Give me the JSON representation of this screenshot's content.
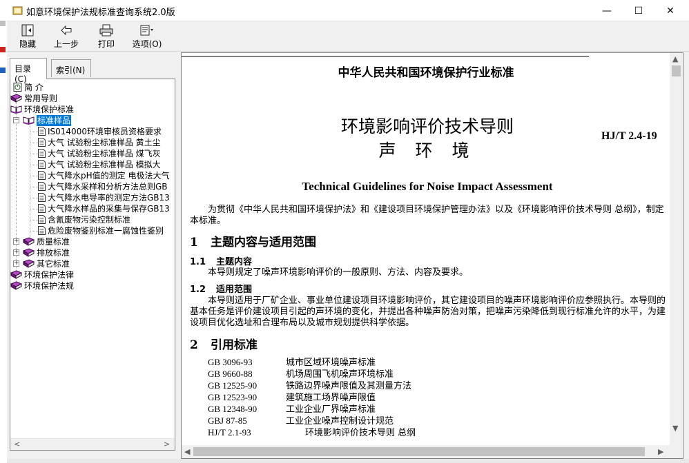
{
  "window": {
    "title": "如意环境保护法规标准查询系统2.0版",
    "minimize": "—",
    "maximize": "☐",
    "close": "✕"
  },
  "toolbar": {
    "hide": "隐藏",
    "back": "上一步",
    "print": "打印",
    "options": "选项(O)"
  },
  "tabs": {
    "contents": "目录(C)",
    "index": "索引(N)"
  },
  "tree": {
    "items": [
      {
        "label": "简  介",
        "icon": "help-page-icon"
      },
      {
        "label": "常用导则",
        "icon": "book-icon"
      },
      {
        "label": "环境保护标准",
        "icon": "book-open-icon"
      },
      {
        "label": "标准样品",
        "icon": "book-open-icon"
      },
      {
        "label": "IS014000环境审核员资格要求",
        "icon": "page-icon"
      },
      {
        "label": "大气 试验粉尘标准样品 黄土尘",
        "icon": "page-icon"
      },
      {
        "label": "大气 试验粉尘标准样品 煤飞灰",
        "icon": "page-icon"
      },
      {
        "label": "大气 试验粉尘标准样品 模拟大",
        "icon": "page-icon"
      },
      {
        "label": "大气降水pH值的测定 电极法大气",
        "icon": "page-icon"
      },
      {
        "label": "大气降水采样和分析方法总则GB",
        "icon": "page-icon"
      },
      {
        "label": "大气降水电导率的测定方法GB13",
        "icon": "page-icon"
      },
      {
        "label": "大气降水样品的采集与保存GB13",
        "icon": "page-icon"
      },
      {
        "label": "含氰废物污染控制标准",
        "icon": "page-icon"
      },
      {
        "label": "危险废物鉴别标准一腐蚀性鉴别",
        "icon": "page-icon"
      },
      {
        "label": "质量标准",
        "icon": "book-icon"
      },
      {
        "label": "排放标准",
        "icon": "book-icon"
      },
      {
        "label": "其它标准",
        "icon": "book-icon"
      },
      {
        "label": "环境保护法律",
        "icon": "book-icon"
      },
      {
        "label": "环境保护法规",
        "icon": "book-icon"
      }
    ]
  },
  "doc": {
    "header": "中华人民共和国环境保护行业标准",
    "title_line1": "环境影响评价技术导则",
    "title_line2": "声 环 境",
    "code": "HJ/T 2.4-19",
    "english_title": "Technical Guidelines for Noise Impact Assessment",
    "intro": "为贯彻《中华人民共和国环境保护法》和《建设项目环境保护管理办法》以及《环境影响评价技术导则 总纲》，制定本标准。",
    "s1_num": "1",
    "s1_title": "主题内容与适用范围",
    "s11_num": "1.1",
    "s11_title": "主题内容",
    "s11_text": "本导则规定了噪声环境影响评价的一般原则、方法、内容及要求。",
    "s12_num": "1.2",
    "s12_title": "适用范围",
    "s12_text": "本导则适用于厂矿企业、事业单位建设项目环境影响评价，其它建设项目的噪声环境影响评价应参照执行。本导则的基本任务是评价建设项目引起的声环境的变化，并提出各种噪声防治对策，把噪声污染降低到现行标准允许的水平，为建设项目优化选址和合理布局以及城市规划提供科学依据。",
    "s2_num": "2",
    "s2_title": "引用标准",
    "refs": [
      {
        "code": "GB    3096-93",
        "name": "城市区域环境噪声标准"
      },
      {
        "code": "GB    9660-88",
        "name": "机场周围飞机噪声环境标准"
      },
      {
        "code": "GB    12525-90",
        "name": "铁路边界噪声限值及其测量方法"
      },
      {
        "code": "GB    12523-90",
        "name": "建筑施工场界噪声限值"
      },
      {
        "code": "GB    12348-90",
        "name": "工业企业厂界噪声标准"
      },
      {
        "code": "GBJ 87-85",
        "name": "工业企业噪声控制设计规范"
      },
      {
        "code": "HJ/T      2.1-93",
        "name": "环境影响评价技术导则 总纲"
      }
    ]
  },
  "colors": {
    "selection": "#0078d7",
    "book_purple": "#7a2a8a"
  }
}
